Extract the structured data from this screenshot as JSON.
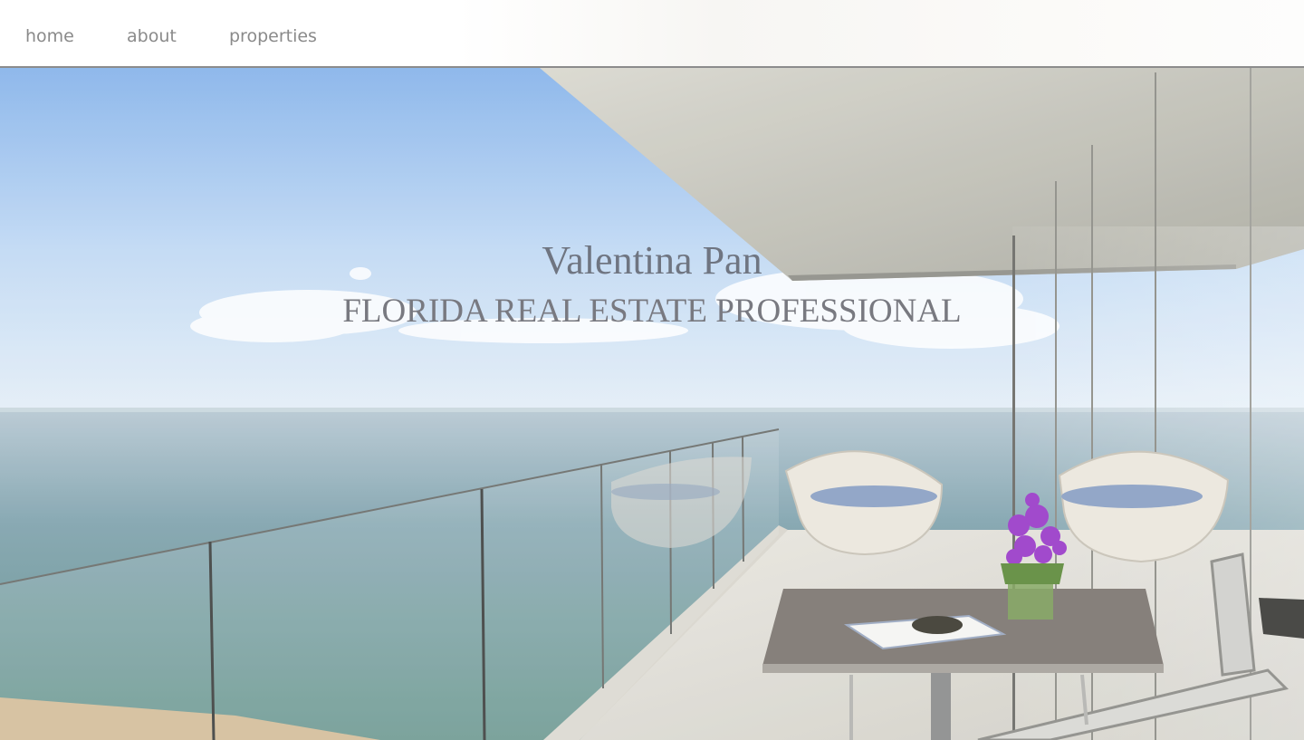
{
  "nav": {
    "items": [
      {
        "label": "home"
      },
      {
        "label": "about"
      },
      {
        "label": "properties"
      }
    ]
  },
  "hero": {
    "name": "Valentina Pan",
    "tagline": "FLORIDA REAL ESTATE PROFESSIONAL"
  },
  "colors": {
    "nav_text": "#8a8a8a",
    "title_text": "#6f7581",
    "sky": "#a9cbf0",
    "sea": "#5f8f8c"
  }
}
